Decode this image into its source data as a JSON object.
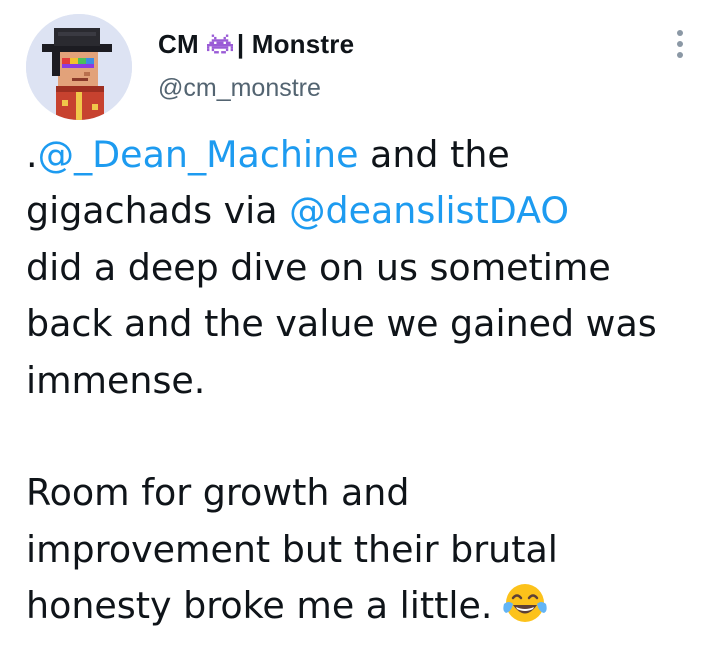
{
  "author": {
    "display_name_first": "CM",
    "display_name_second": "| Monstre",
    "name_emoji": "space-invader-icon",
    "handle": "@cm_monstre",
    "avatar": "pixel-art-avatar"
  },
  "menu": {
    "icon": "more-options-icon"
  },
  "tweet": {
    "line1_prefix": ".",
    "line1_mention": "@_Dean_Machine",
    "line1_suffix": " and the",
    "line2_prefix": "gigachads via ",
    "line2_mention": "@deanslistDAO",
    "line3": "did a deep dive on us sometime",
    "line4": "back and the value we gained was",
    "line5": "immense.",
    "line6": "Room for growth and",
    "line7": "improvement but their brutal",
    "line8": "honesty broke me a little.",
    "end_emoji": "tears-of-joy-emoji"
  },
  "colors": {
    "link": "#1d9bf0",
    "text": "#0f1419",
    "secondary": "#536471"
  }
}
